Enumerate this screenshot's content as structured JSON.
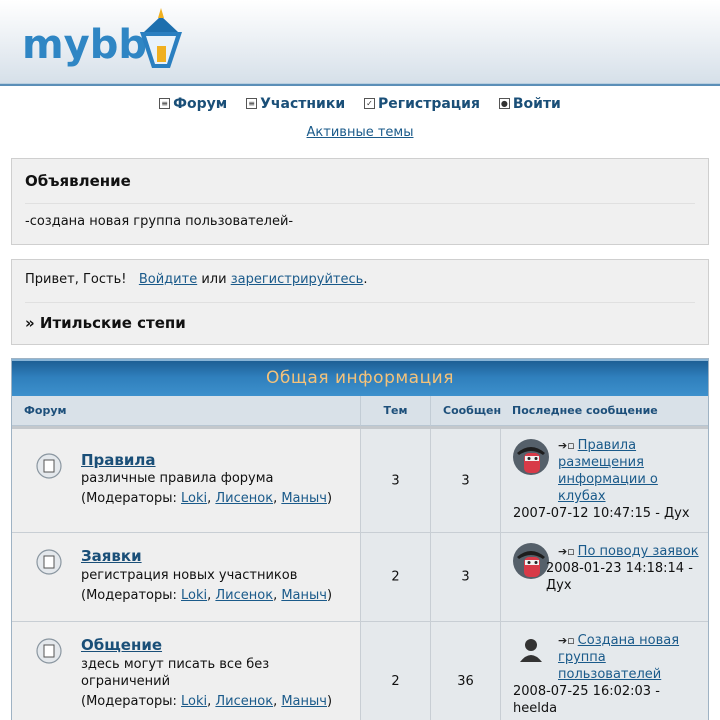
{
  "header": {
    "logo_text": "mybb"
  },
  "nav": {
    "forum": "Форум",
    "members": "Участники",
    "register": "Регистрация",
    "login": "Войти",
    "active_topics": "Активные темы"
  },
  "announcement": {
    "title": "Объявление",
    "text": "-создана новая группа пользователей-"
  },
  "welcome": {
    "hello": "Привет, Гость!",
    "login_link": "Войдите",
    "or": "или",
    "register_link": "зарегистрируйтесь",
    "period": ".",
    "breadcrumb": "» Итильские степи"
  },
  "category": {
    "title": "Общая информация",
    "columns": {
      "forum": "Форум",
      "topics": "Тем",
      "posts": "Сообщений",
      "last": "Последнее сообщение"
    }
  },
  "moderators_label": "(Модераторы:",
  "moderators": [
    "Loki",
    "Лисенок",
    "Маныч"
  ],
  "forums": [
    {
      "name": "Правила",
      "description": "различные правила форума",
      "topics": "3",
      "posts": "3",
      "last_title": "Правила размещения информации о клубах",
      "last_meta": "2007-07-12 10:47:15 - Дух"
    },
    {
      "name": "Заявки",
      "description": "регистрация новых участников",
      "topics": "2",
      "posts": "3",
      "last_title": "По поводу заявок",
      "last_meta": "2008-01-23 14:18:14 - Дух"
    },
    {
      "name": "Общение",
      "description": "здесь могут писать все без ограничений",
      "topics": "2",
      "posts": "36",
      "last_title": "Создана новая группа пользователей",
      "last_meta": "2008-07-25 16:02:03 - heelda"
    }
  ]
}
